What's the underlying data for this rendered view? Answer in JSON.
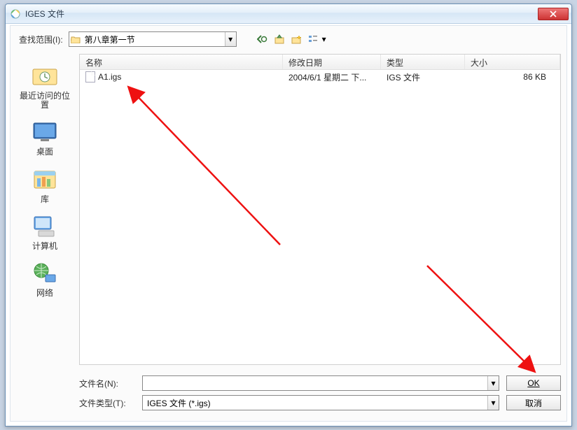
{
  "title": "IGES 文件",
  "lookin_label": "查找范围(I):",
  "path_text": "第八章第一节",
  "columns": {
    "name": "名称",
    "date": "修改日期",
    "type": "类型",
    "size": "大小"
  },
  "file": {
    "name": "A1.igs",
    "date": "2004/6/1 星期二 下...",
    "type": "IGS 文件",
    "size": "86 KB"
  },
  "places": {
    "recent": "最近访问的位置",
    "desktop": "桌面",
    "libraries": "库",
    "computer": "计算机",
    "network": "网络"
  },
  "filename_label": "文件名(N):",
  "filetype_label": "文件类型(T):",
  "filetype_value": "IGES 文件 (*.igs)",
  "ok_label": "OK",
  "cancel_label": "取消"
}
